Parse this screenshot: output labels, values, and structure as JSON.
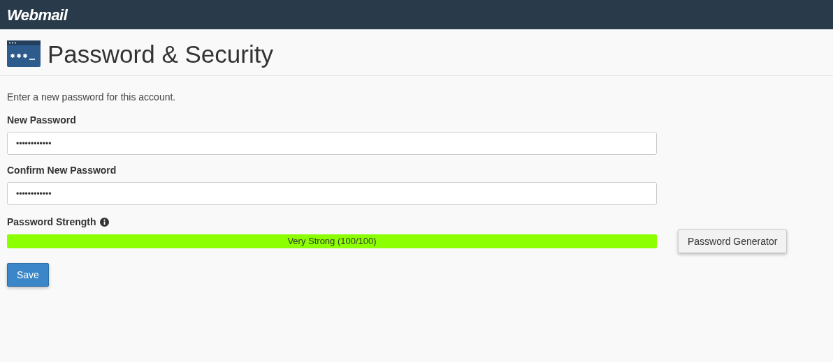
{
  "header": {
    "logo": "Webmail"
  },
  "page_title": "Password & Security",
  "intro": "Enter a new password for this account.",
  "fields": [
    {
      "label": "New Password",
      "value": "••••••••••••"
    },
    {
      "label": "Confirm New Password",
      "value": "••••••••••••"
    }
  ],
  "strength": {
    "label": "Password Strength",
    "level": 1.0,
    "reading": "Very Strong (100/100)"
  },
  "generator_button": "Password Generator",
  "save_button": "Save"
}
